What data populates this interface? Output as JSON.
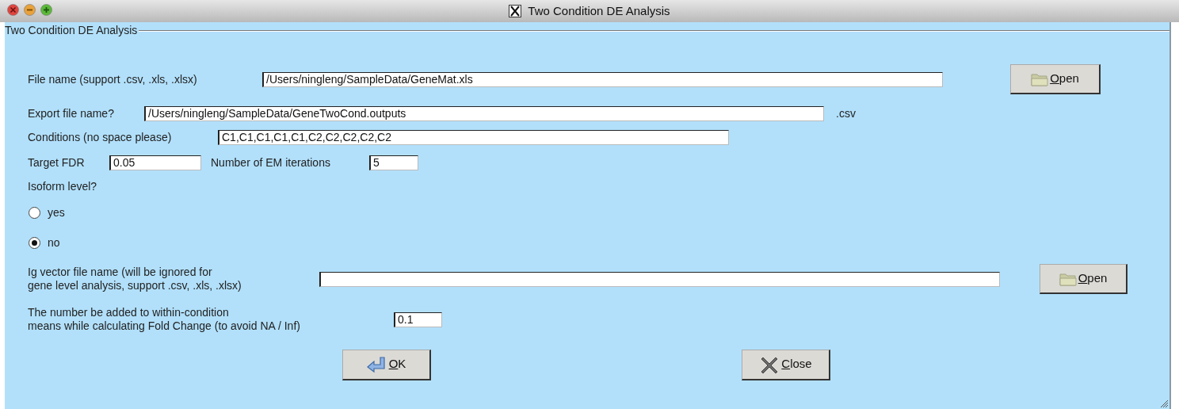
{
  "window": {
    "title": "Two Condition DE Analysis"
  },
  "group_label": "Two Condition DE Analysis",
  "file_name": {
    "label": "File name (support .csv, .xls, .xlsx)",
    "value": "/Users/ningleng/SampleData/GeneMat.xls",
    "button": "Open"
  },
  "export_file": {
    "label": "Export file name?",
    "value": "/Users/ningleng/SampleData/GeneTwoCond.outputs",
    "suffix": ".csv"
  },
  "conditions": {
    "label": "Conditions (no space please)",
    "value": "C1,C1,C1,C1,C1,C2,C2,C2,C2,C2"
  },
  "target_fdr": {
    "label": "Target FDR",
    "value": "0.05"
  },
  "em_iterations": {
    "label": "Number of EM iterations",
    "value": "5"
  },
  "isoform": {
    "label": "Isoform level?",
    "options": [
      {
        "label": "yes",
        "selected": false
      },
      {
        "label": "no",
        "selected": true
      }
    ]
  },
  "ig_vector": {
    "label_lines": [
      "Ig vector file name (will be ignored for",
      "gene level analysis, support .csv, .xls, .xlsx)"
    ],
    "button": "Open"
  },
  "fold_change": {
    "label_lines": [
      "The number be added to within-condition",
      "means while calculating Fold Change (to avoid NA / Inf)"
    ],
    "value": "0.1"
  },
  "buttons": [
    {
      "label": "OK",
      "kind": "ok"
    },
    {
      "label": "Close",
      "kind": "close"
    }
  ]
}
